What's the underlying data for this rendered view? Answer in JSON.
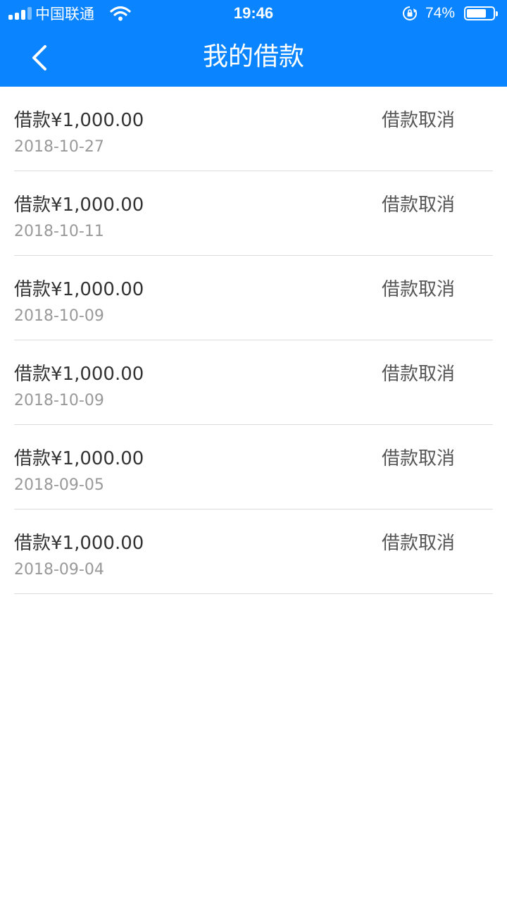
{
  "status_bar": {
    "carrier": "中国联通",
    "time": "19:46",
    "battery_percent_text": "74%",
    "battery_level": 0.74,
    "icons": [
      "signal-icon",
      "wifi-icon",
      "orientation-lock-icon",
      "battery-icon"
    ]
  },
  "nav": {
    "title": "我的借款",
    "back_icon": "chevron-left-icon"
  },
  "colors": {
    "header_bg": "#0A84FF",
    "text_primary": "#333333",
    "text_secondary": "#999999",
    "divider": "#dcdcdc"
  },
  "loans": [
    {
      "title": "借款¥1,000.00",
      "date": "2018-10-27",
      "status": "借款取消"
    },
    {
      "title": "借款¥1,000.00",
      "date": "2018-10-11",
      "status": "借款取消"
    },
    {
      "title": "借款¥1,000.00",
      "date": "2018-10-09",
      "status": "借款取消"
    },
    {
      "title": "借款¥1,000.00",
      "date": "2018-10-09",
      "status": "借款取消"
    },
    {
      "title": "借款¥1,000.00",
      "date": "2018-09-05",
      "status": "借款取消"
    },
    {
      "title": "借款¥1,000.00",
      "date": "2018-09-04",
      "status": "借款取消"
    }
  ]
}
